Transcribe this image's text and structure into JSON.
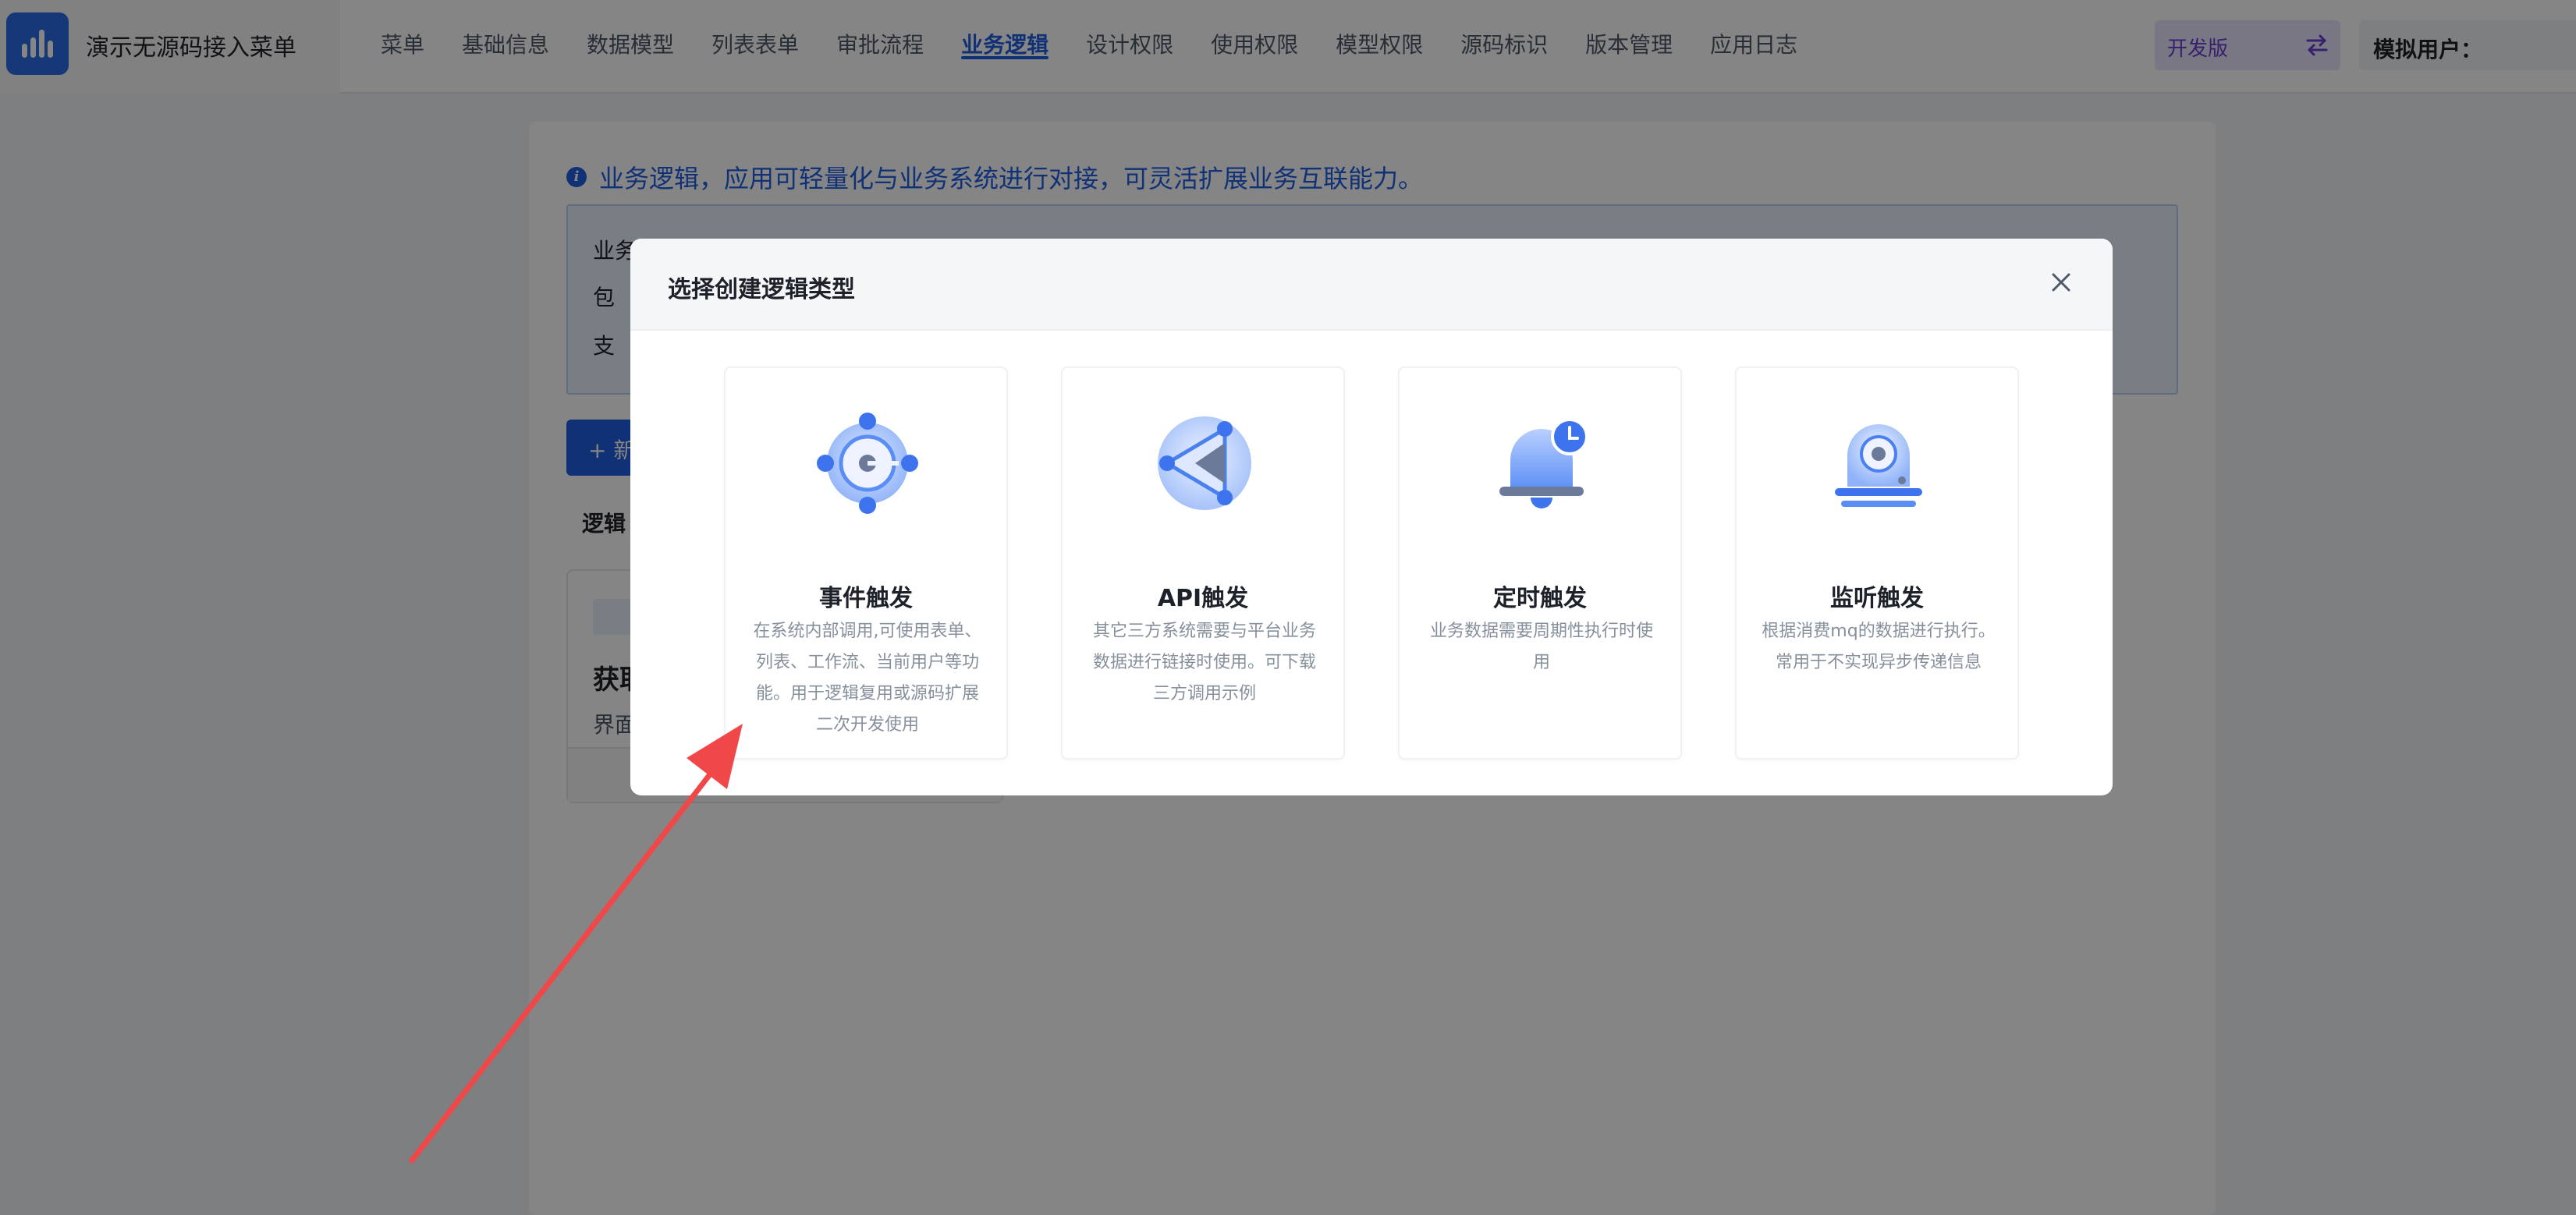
{
  "app": {
    "title": "演示无源码接入菜单"
  },
  "nav": {
    "items": [
      "菜单",
      "基础信息",
      "数据模型",
      "列表表单",
      "审批流程",
      "业务逻辑",
      "设计权限",
      "使用权限",
      "模型权限",
      "源码标识",
      "版本管理",
      "应用日志"
    ],
    "active_index": 5
  },
  "header": {
    "edition_label": "开发版",
    "sim_user_label": "模拟用户："
  },
  "page": {
    "info_line": "业务逻辑，应用可轻量化与业务系统进行对接，可灵活扩展业务互联能力。",
    "note_line1": "业务",
    "note_line2": "包",
    "note_line3": "支",
    "new_button": "+ 新",
    "list_title": "逻辑",
    "card_name": "获取",
    "card_sub": "界面"
  },
  "modal": {
    "title": "选择创建逻辑类型",
    "cards": [
      {
        "title": "事件触发",
        "desc": "在系统内部调用,可使用表单、列表、工作流、当前用户等功能。用于逻辑复用或源码扩展二次开发使用",
        "icon": "event-trigger-icon"
      },
      {
        "title": "API触发",
        "desc": "其它三方系统需要与平台业务数据进行链接时使用。可下载三方调用示例",
        "icon": "api-trigger-icon"
      },
      {
        "title": "定时触发",
        "desc": "业务数据需要周期性执行时使用",
        "icon": "timer-trigger-icon"
      },
      {
        "title": "监听触发",
        "desc": "根据消费mq的数据进行执行。常用于不实现异步传递信息",
        "icon": "listen-trigger-icon"
      }
    ]
  },
  "colors": {
    "primary": "#1f5fe0",
    "edition_text": "#6a3fd1",
    "arrow": "#f04848"
  }
}
